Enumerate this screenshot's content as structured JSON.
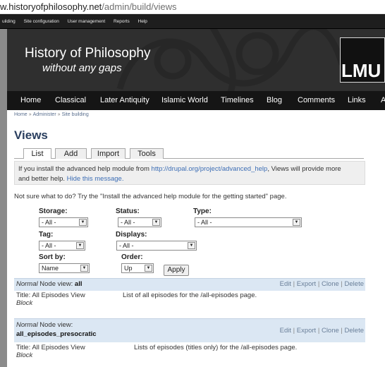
{
  "browser": {
    "url_domain": "w.historyofphilosophy.net",
    "url_path": "/admin/build/views"
  },
  "admin_menu": {
    "items": [
      "uilding",
      "Site configuration",
      "User management",
      "Reports",
      "Help"
    ]
  },
  "site": {
    "name": "History of Philosophy",
    "slogan": "without any gaps",
    "logo_text": "LMU"
  },
  "main_nav": {
    "items": [
      "Home",
      "Classical",
      "Later Antiquity",
      "Islamic World",
      "Timelines",
      "Blog",
      "Comments",
      "Links",
      "A"
    ]
  },
  "breadcrumb": {
    "items": [
      "Home",
      "Administer",
      "Site building"
    ],
    "separator": "»"
  },
  "page": {
    "title": "Views",
    "tabs": [
      "List",
      "Add",
      "Import",
      "Tools"
    ],
    "active_tab": "List"
  },
  "help": {
    "text_before": "If you install the advanced help module from ",
    "link_url": "http://drupal.org/project/advanced_help",
    "text_after": ", Views will provide more",
    "line2_before": "and better help. ",
    "hide_link": "Hide this message."
  },
  "not_sure_text": "Not sure what to do? Try the \"Install the advanced help module for the getting started\" page.",
  "filters": {
    "storage": {
      "label": "Storage:",
      "value": "- All -"
    },
    "status": {
      "label": "Status:",
      "value": "- All -"
    },
    "type": {
      "label": "Type:",
      "value": "- All -"
    },
    "tag": {
      "label": "Tag:",
      "value": "- All -"
    },
    "displays": {
      "label": "Displays:",
      "value": "- All -"
    },
    "sort_by": {
      "label": "Sort by:",
      "value": "Name"
    },
    "order": {
      "label": "Order:",
      "value": "Up"
    },
    "apply_label": "Apply",
    "arrow_glyph": "▼"
  },
  "views": [
    {
      "storage": "Normal",
      "type_label": "Node view:",
      "name": "all",
      "title_line": "Title: All Episodes View",
      "description": "List of all episodes for the /all-episodes page.",
      "display": "Block",
      "actions": [
        "Edit",
        "Export",
        "Clone",
        "Delete"
      ]
    },
    {
      "storage": "Normal",
      "type_label": "Node view:",
      "name": "all_episodes_presocratic",
      "title_line": "Title: All Episodes View",
      "description": "Lists of episodes (titles only) for the /all-episodes page.",
      "display": "Block",
      "actions": [
        "Edit",
        "Export",
        "Clone",
        "Delete"
      ]
    }
  ],
  "colors": {
    "admin_bar": "#1e1e1e",
    "header_bg": "#2f2f2f",
    "nav_bg": "#151515",
    "title": "#2a3f5f",
    "link": "#3d6eb5",
    "view_header_bg": "#dbe7f3"
  }
}
